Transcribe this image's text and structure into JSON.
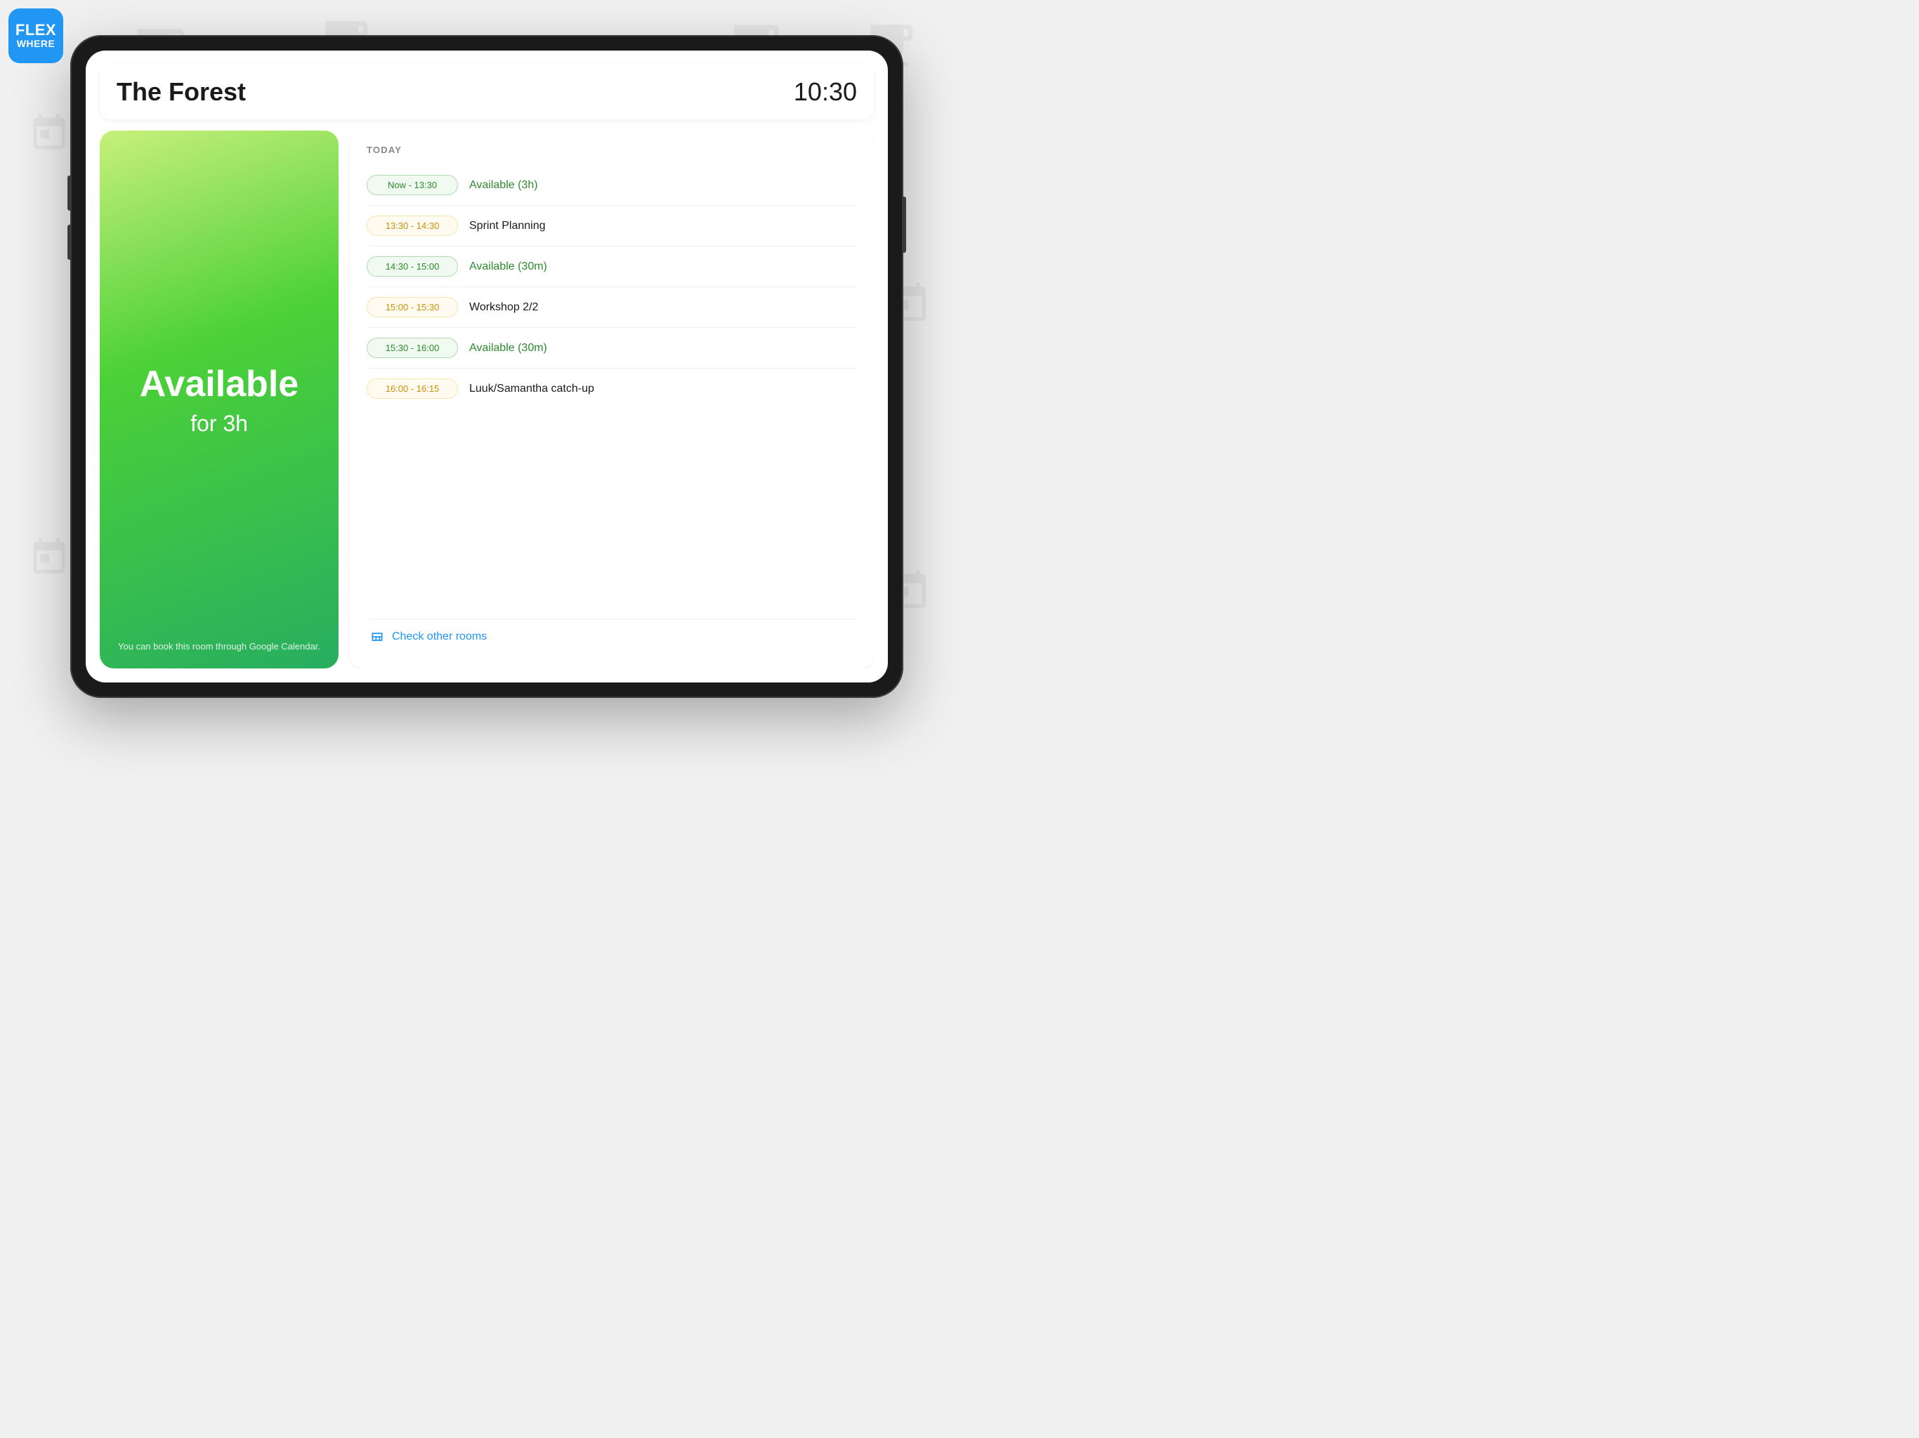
{
  "app": {
    "logo_line1": "FLEX",
    "logo_line2": "WHERE"
  },
  "header": {
    "room_name": "The Forest",
    "current_time": "10:30"
  },
  "availability": {
    "status": "Available",
    "duration": "for 3h",
    "booking_hint": "You can book this room through Google Calendar."
  },
  "schedule": {
    "label": "TODAY",
    "items": [
      {
        "time": "Now - 13:30",
        "event": "Available (3h)",
        "type": "available"
      },
      {
        "time": "13:30 - 14:30",
        "event": "Sprint Planning",
        "type": "booked"
      },
      {
        "time": "14:30 - 15:00",
        "event": "Available (30m)",
        "type": "available"
      },
      {
        "time": "15:00 - 15:30",
        "event": "Workshop 2/2",
        "type": "booked"
      },
      {
        "time": "15:30 - 16:00",
        "event": "Available (30m)",
        "type": "available"
      },
      {
        "time": "16:00 - 16:15",
        "event": "Luuk/Samantha catch-up",
        "type": "booked"
      }
    ],
    "check_rooms_label": "Check other rooms"
  }
}
